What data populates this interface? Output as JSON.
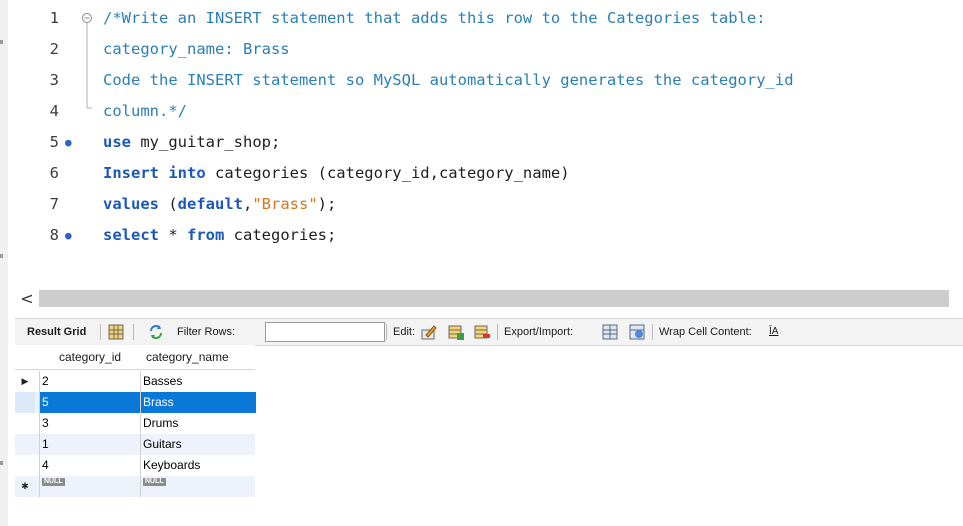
{
  "editor": {
    "lines": [
      {
        "no": "1",
        "dot": false,
        "tokens": [
          {
            "t": "/*Write an INSERT statement that adds this row to the Categories table:",
            "c": "cm"
          }
        ]
      },
      {
        "no": "2",
        "dot": false,
        "tokens": [
          {
            "t": "category_name: Brass",
            "c": "cm"
          }
        ]
      },
      {
        "no": "3",
        "dot": false,
        "tokens": [
          {
            "t": "Code the INSERT statement so MySQL automatically generates the category_id",
            "c": "cm"
          }
        ]
      },
      {
        "no": "4",
        "dot": false,
        "tokens": [
          {
            "t": "column.*/",
            "c": "cm"
          }
        ]
      },
      {
        "no": "5",
        "dot": true,
        "tokens": [
          {
            "t": "use",
            "c": "kw"
          },
          {
            "t": " my_guitar_shop;",
            "c": "id"
          }
        ]
      },
      {
        "no": "6",
        "dot": false,
        "tokens": [
          {
            "t": "Insert into",
            "c": "kw"
          },
          {
            "t": " categories (category_id,category_name)",
            "c": "id"
          }
        ]
      },
      {
        "no": "7",
        "dot": false,
        "tokens": [
          {
            "t": "values",
            "c": "kw"
          },
          {
            "t": " (",
            "c": "id"
          },
          {
            "t": "default",
            "c": "kw"
          },
          {
            "t": ",",
            "c": "id"
          },
          {
            "t": "\"Brass\"",
            "c": "str"
          },
          {
            "t": ");",
            "c": "id"
          }
        ]
      },
      {
        "no": "8",
        "dot": true,
        "tokens": [
          {
            "t": "select",
            "c": "kw"
          },
          {
            "t": " * ",
            "c": "id"
          },
          {
            "t": "from",
            "c": "kw"
          },
          {
            "t": " categories;",
            "c": "id"
          }
        ]
      }
    ],
    "dot_glyph": "●"
  },
  "scroll": {
    "left_arrow": "<"
  },
  "toolbar": {
    "result_grid": "Result Grid",
    "filter_rows": "Filter Rows:",
    "edit": "Edit:",
    "export_import": "Export/Import:",
    "wrap": "Wrap Cell Content:",
    "wrap_icon_glyph": "ĪA"
  },
  "grid": {
    "columns": [
      "category_id",
      "category_name"
    ],
    "rows": [
      {
        "id": "2",
        "name": "Basses",
        "selected": false,
        "current": true
      },
      {
        "id": "5",
        "name": "Brass",
        "selected": true,
        "current": false
      },
      {
        "id": "3",
        "name": "Drums",
        "selected": false,
        "current": false
      },
      {
        "id": "1",
        "name": "Guitars",
        "selected": false,
        "current": false
      },
      {
        "id": "4",
        "name": "Keyboards",
        "selected": false,
        "current": false
      }
    ],
    "new_row": {
      "id": "NULL",
      "name": "NULL"
    },
    "current_marker": "▶",
    "new_marker": "✱"
  },
  "colors": {
    "accent": "#0a78d7",
    "keyword": "#1c58b8",
    "comment": "#2a7fb8",
    "string": "#d3761c"
  }
}
